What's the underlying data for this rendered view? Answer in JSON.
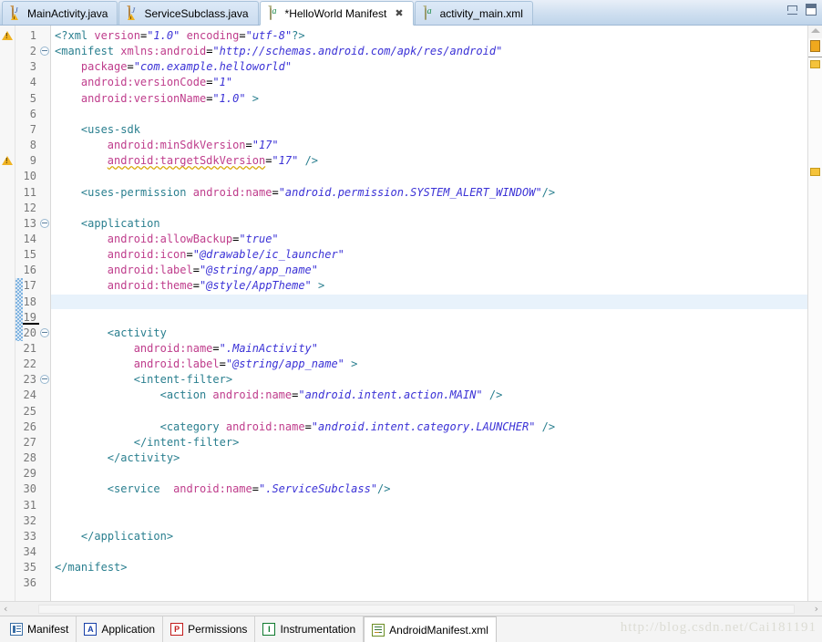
{
  "window": {
    "minimize_label": "Minimize",
    "maximize_label": "Maximize"
  },
  "editor_tabs": [
    {
      "label": "MainActivity.java",
      "icon": "java-file-warning-icon",
      "active": false,
      "dirty": false
    },
    {
      "label": "ServiceSubclass.java",
      "icon": "java-file-warning-icon",
      "active": false,
      "dirty": false
    },
    {
      "label": "*HelloWorld Manifest",
      "icon": "xml-file-icon",
      "active": true,
      "dirty": true,
      "close": "✖"
    },
    {
      "label": "activity_main.xml",
      "icon": "xml-file-icon",
      "active": false,
      "dirty": false
    }
  ],
  "gutter": {
    "lines": [
      "1",
      "2",
      "3",
      "4",
      "5",
      "6",
      "7",
      "8",
      "9",
      "10",
      "11",
      "12",
      "13",
      "14",
      "15",
      "16",
      "17",
      "18",
      "19",
      "20",
      "21",
      "22",
      "23",
      "24",
      "25",
      "26",
      "27",
      "28",
      "29",
      "30",
      "31",
      "32",
      "33",
      "34",
      "35",
      "36"
    ],
    "warning_lines": [
      1,
      9
    ],
    "fold_lines": [
      2,
      13,
      20,
      23
    ],
    "current_line": 18,
    "caret_line": 19,
    "changed_lines": [
      17,
      18,
      19,
      20
    ]
  },
  "code": {
    "lines": [
      "<?xml version=\"1.0\" encoding=\"utf-8\"?>",
      "<manifest xmlns:android=\"http://schemas.android.com/apk/res/android\"",
      "    package=\"com.example.helloworld\"",
      "    android:versionCode=\"1\"",
      "    android:versionName=\"1.0\" >",
      "",
      "    <uses-sdk",
      "        android:minSdkVersion=\"17\"",
      "        android:targetSdkVersion=\"17\" />",
      "",
      "    <uses-permission android:name=\"android.permission.SYSTEM_ALERT_WINDOW\"/>",
      "",
      "    <application",
      "        android:allowBackup=\"true\"",
      "        android:icon=\"@drawable/ic_launcher\"",
      "        android:label=\"@string/app_name\"",
      "        android:theme=\"@style/AppTheme\" >",
      "",
      "",
      "        <activity",
      "            android:name=\".MainActivity\"",
      "            android:label=\"@string/app_name\" >",
      "            <intent-filter>",
      "                <action android:name=\"android.intent.action.MAIN\" />",
      "",
      "                <category android:name=\"android.intent.category.LAUNCHER\" />",
      "            </intent-filter>",
      "        </activity>",
      "",
      "        <service  android:name=\".ServiceSubclass\"/>",
      "",
      "",
      "    </application>",
      "",
      "</manifest>",
      ""
    ]
  },
  "scrollbar": {
    "left_arrow": "‹",
    "right_arrow": "›"
  },
  "overview_ruler": {
    "up_arrow": "collapse-arrow-icon",
    "markers": [
      "warning",
      "warning",
      "warning"
    ]
  },
  "page_tabs": [
    {
      "label": "Manifest",
      "icon": "manifest-icon",
      "badge": "",
      "active": false
    },
    {
      "label": "Application",
      "icon": "application-icon",
      "badge": "A",
      "active": false
    },
    {
      "label": "Permissions",
      "icon": "permissions-icon",
      "badge": "P",
      "active": false
    },
    {
      "label": "Instrumentation",
      "icon": "instrumentation-icon",
      "badge": "I",
      "active": false
    },
    {
      "label": "AndroidManifest.xml",
      "icon": "xml-source-icon",
      "badge": "",
      "active": true
    }
  ],
  "watermark": {
    "text": "http://blog.csdn.net/Cai181191"
  },
  "colors": {
    "tag": "#2a7f8f",
    "attribute": "#bf3d8c",
    "value": "#3b32d6",
    "current_line_highlight": "#e8f2fb",
    "change_bar": "#7fb3e0",
    "warning": "#f0b323"
  }
}
